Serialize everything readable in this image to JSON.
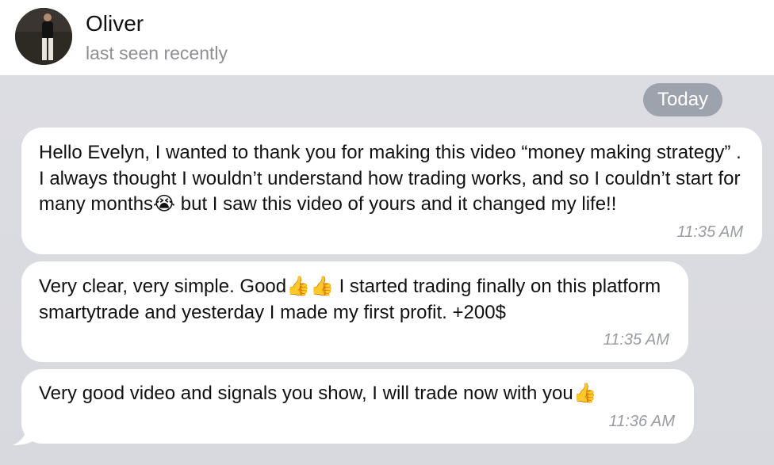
{
  "contact": {
    "name": "Oliver",
    "status": "last seen recently"
  },
  "chat": {
    "date_label": "Today",
    "messages": [
      {
        "text": "Hello Evelyn, I wanted to thank you for making this video “money making strategy” . I always thought I wouldn’t understand how trading works, and so I couldn’t start for many months😭 but I saw this video of yours and it changed my life!!",
        "time": "11:35 AM"
      },
      {
        "text": "Very clear, very simple. Good👍👍 I started trading finally on this platform smartytrade and yesterday I made my first profit. +200$",
        "time": "11:35 AM"
      },
      {
        "text": "Very good video and signals you show, I will trade now with you👍",
        "time": "11:36 AM"
      }
    ]
  },
  "colors": {
    "chat_background": "#dcdde2",
    "bubble": "#ffffff",
    "date_pill": "#9da3ad",
    "secondary_text": "#8e8e93"
  }
}
